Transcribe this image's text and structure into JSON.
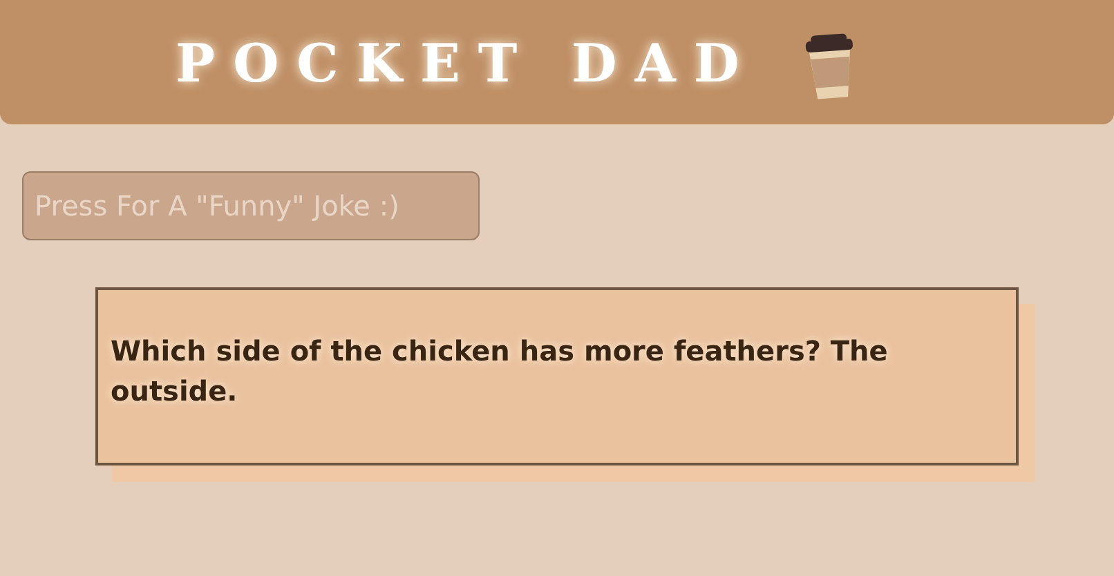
{
  "header": {
    "title": "POCKET DAD"
  },
  "joke_button": {
    "label": "Press For A \"Funny\" Joke :)"
  },
  "joke": {
    "text": "Which side of the chicken has more feathers? The outside."
  }
}
